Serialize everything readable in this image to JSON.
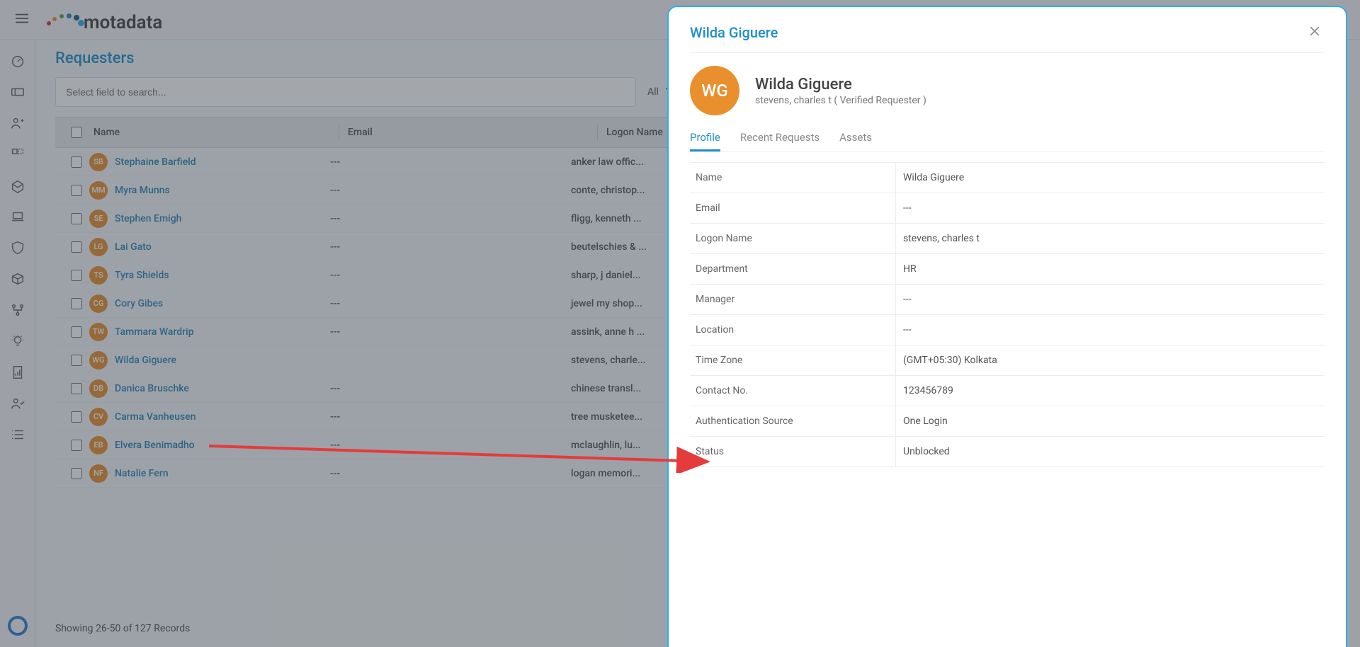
{
  "app": {
    "logo_text": "motadata"
  },
  "page": {
    "title": "Requesters"
  },
  "search": {
    "placeholder": "Select field to search...",
    "filter_label": "All"
  },
  "columns": {
    "name": "Name",
    "email": "Email",
    "logon": "Logon Name"
  },
  "rows": [
    {
      "initials": "SB",
      "name": "Stephaine Barfield",
      "email": "---",
      "logon": "anker law offic..."
    },
    {
      "initials": "MM",
      "name": "Myra Munns",
      "email": "---",
      "logon": "conte, christop..."
    },
    {
      "initials": "SE",
      "name": "Stephen Emigh",
      "email": "---",
      "logon": "fligg, kenneth ..."
    },
    {
      "initials": "LG",
      "name": "Lai Gato",
      "email": "---",
      "logon": "beutelschies & ..."
    },
    {
      "initials": "TS",
      "name": "Tyra Shields",
      "email": "---",
      "logon": "sharp, j daniel..."
    },
    {
      "initials": "CG",
      "name": "Cory Gibes",
      "email": "---",
      "logon": "jewel my shop..."
    },
    {
      "initials": "TW",
      "name": "Tammara Wardrip",
      "email": "---",
      "logon": "assink, anne h ..."
    },
    {
      "initials": "WG",
      "name": "Wilda Giguere",
      "email": "",
      "logon": "stevens, charle..."
    },
    {
      "initials": "DB",
      "name": "Danica Bruschke",
      "email": "---",
      "logon": "chinese transl..."
    },
    {
      "initials": "CV",
      "name": "Carma Vanheusen",
      "email": "---",
      "logon": "tree musketee..."
    },
    {
      "initials": "EB",
      "name": "Elvera Benimadho",
      "email": "---",
      "logon": "mclaughlin, lu..."
    },
    {
      "initials": "NF",
      "name": "Natalie Fern",
      "email": "---",
      "logon": "logan memori..."
    }
  ],
  "footer": {
    "records_text": "Showing 26-50 of 127 Records"
  },
  "panel": {
    "title": "Wilda Giguere",
    "avatar_initials": "WG",
    "name": "Wilda Giguere",
    "subtitle": "stevens, charles t  ( Verified Requester )",
    "tabs": {
      "profile": "Profile",
      "recent": "Recent Requests",
      "assets": "Assets"
    },
    "details": [
      {
        "label": "Name",
        "value": "Wilda Giguere"
      },
      {
        "label": "Email",
        "value": "---"
      },
      {
        "label": "Logon Name",
        "value": "stevens, charles t"
      },
      {
        "label": "Department",
        "value": "HR"
      },
      {
        "label": "Manager",
        "value": "---"
      },
      {
        "label": "Location",
        "value": "---"
      },
      {
        "label": "Time Zone",
        "value": "(GMT+05:30) Kolkata"
      },
      {
        "label": "Contact No.",
        "value": "123456789"
      },
      {
        "label": "Authentication Source",
        "value": "One Login"
      },
      {
        "label": "Status",
        "value": "Unblocked"
      }
    ]
  }
}
